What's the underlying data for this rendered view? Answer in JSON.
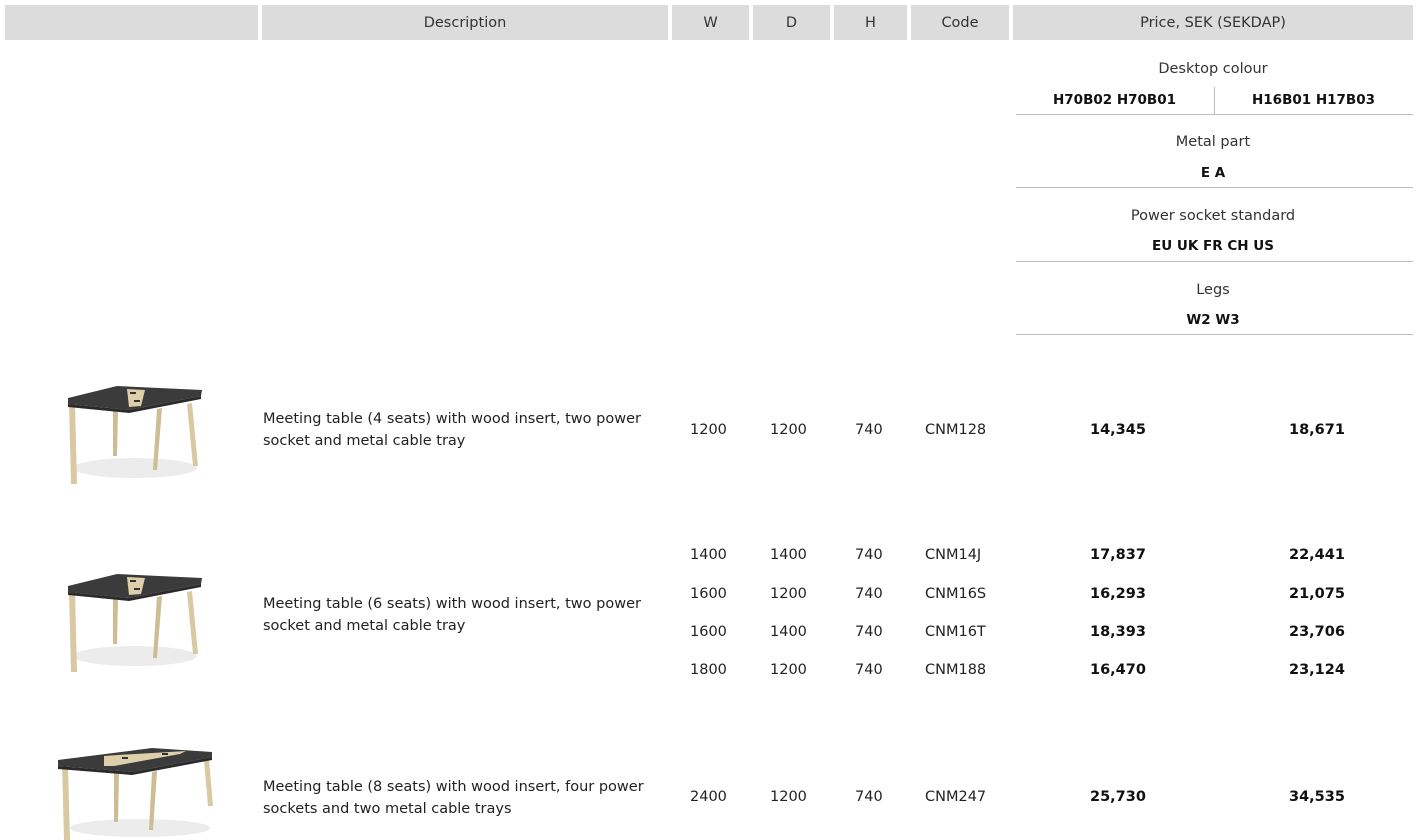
{
  "header": {
    "description": "Description",
    "w": "W",
    "d": "D",
    "h": "H",
    "code": "Code",
    "price": "Price, SEK (SEKDAP)"
  },
  "options": {
    "desktop_colour": {
      "label": "Desktop colour",
      "values": [
        "H70B02 H70B01",
        "H16B01 H17B03"
      ]
    },
    "metal_part": {
      "label": "Metal part",
      "value": "E A"
    },
    "power_socket": {
      "label": "Power socket standard",
      "value": "EU UK FR CH US"
    },
    "legs": {
      "label": "Legs",
      "value": "W2 W3"
    }
  },
  "products": [
    {
      "image": "meeting-table-4-seats",
      "description": "Meeting table (4 seats) with wood insert, two power socket and metal cable tray",
      "rows": [
        {
          "w": "1200",
          "d": "1200",
          "h": "740",
          "code": "CNM128",
          "price1": "14,345",
          "price2": "18,671"
        }
      ]
    },
    {
      "image": "meeting-table-6-seats",
      "description": "Meeting table (6 seats) with wood insert, two power socket and metal cable tray",
      "rows": [
        {
          "w": "1400",
          "d": "1400",
          "h": "740",
          "code": "CNM14J",
          "price1": "17,837",
          "price2": "22,441"
        },
        {
          "w": "1600",
          "d": "1200",
          "h": "740",
          "code": "CNM16S",
          "price1": "16,293",
          "price2": "21,075"
        },
        {
          "w": "1600",
          "d": "1400",
          "h": "740",
          "code": "CNM16T",
          "price1": "18,393",
          "price2": "23,706"
        },
        {
          "w": "1800",
          "d": "1200",
          "h": "740",
          "code": "CNM188",
          "price1": "16,470",
          "price2": "23,124"
        }
      ]
    },
    {
      "image": "meeting-table-8-seats",
      "description": "Meeting table (8 seats) with wood insert, four power sockets and two metal cable trays",
      "rows": [
        {
          "w": "2400",
          "d": "1200",
          "h": "740",
          "code": "CNM247",
          "price1": "25,730",
          "price2": "34,535"
        }
      ]
    }
  ]
}
